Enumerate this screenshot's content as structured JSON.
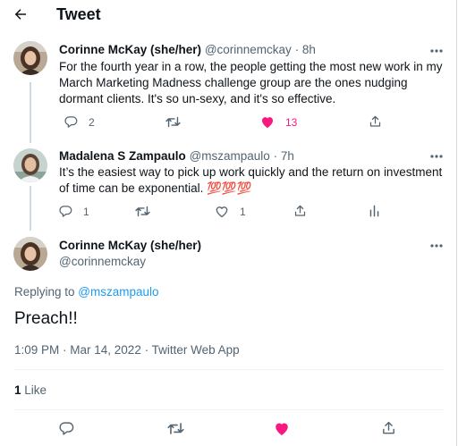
{
  "header": {
    "title": "Tweet"
  },
  "tweets": [
    {
      "name": "Corinne McKay (she/her)",
      "handle": "@corinnemckay",
      "sep": " · ",
      "time": "8h",
      "text": "For the fourth year in a row, the people getting the most new work in my March Marketing Madness challenge group are the ones nudging dormant clients. It's so un-sexy, and it's so effective.",
      "replies": "2",
      "likes": "13"
    },
    {
      "name": "Madalena S Zampaulo",
      "handle": "@mszampaulo",
      "sep": " · ",
      "time": "7h",
      "text": "It’s the easiest way to pick up work quickly and the return on investment of time can be exponential. 💯💯💯",
      "replies": "1",
      "likes": "1"
    }
  ],
  "main_tweet": {
    "name": "Corinne McKay (she/her)",
    "handle": "@corinnemckay",
    "replying_prefix": "Replying to ",
    "replying_to": "@mszampaulo",
    "text": "Preach!!",
    "timestamp": "1:09 PM · Mar 14, 2022 · Twitter Web App",
    "like_count": "1",
    "like_label": " Like"
  },
  "colors": {
    "accent": "#1d9bf0",
    "like": "#f91880",
    "muted": "#536471",
    "text": "#0f1419",
    "divider": "#eff3f4"
  },
  "icons": [
    "back-arrow-icon",
    "more-icon",
    "reply-icon",
    "retweet-icon",
    "heart-icon",
    "share-icon",
    "analytics-icon"
  ]
}
